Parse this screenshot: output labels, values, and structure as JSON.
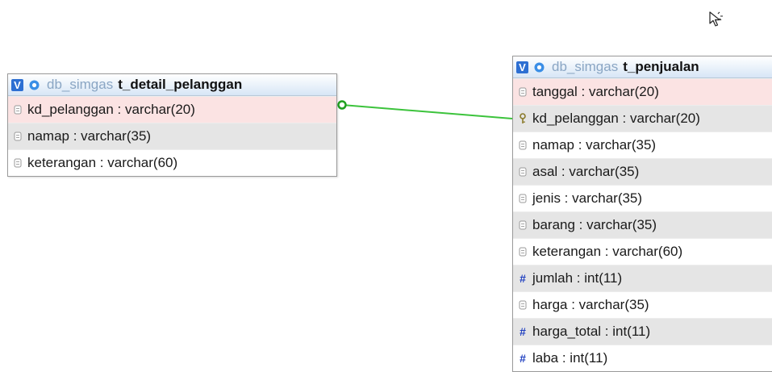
{
  "tables": {
    "detail": {
      "toggle": "V",
      "db": "db_simgas",
      "name": "t_detail_pelanggan",
      "columns": [
        {
          "text": "kd_pelanggan : varchar(20)",
          "type": "text",
          "bg": "pink"
        },
        {
          "text": "namap : varchar(35)",
          "type": "text",
          "bg": "gray"
        },
        {
          "text": "keterangan : varchar(60)",
          "type": "text",
          "bg": "white"
        }
      ]
    },
    "penjualan": {
      "toggle": "V",
      "db": "db_simgas",
      "name": "t_penjualan",
      "columns": [
        {
          "text": "tanggal : varchar(20)",
          "type": "text",
          "bg": "pink"
        },
        {
          "text": "kd_pelanggan : varchar(20)",
          "type": "key",
          "bg": "gray"
        },
        {
          "text": "namap : varchar(35)",
          "type": "text",
          "bg": "white"
        },
        {
          "text": "asal : varchar(35)",
          "type": "text",
          "bg": "gray"
        },
        {
          "text": "jenis : varchar(35)",
          "type": "text",
          "bg": "white"
        },
        {
          "text": "barang : varchar(35)",
          "type": "text",
          "bg": "gray"
        },
        {
          "text": "keterangan : varchar(60)",
          "type": "text",
          "bg": "white"
        },
        {
          "text": "jumlah : int(11)",
          "type": "number",
          "bg": "gray"
        },
        {
          "text": "harga : varchar(35)",
          "type": "text",
          "bg": "white"
        },
        {
          "text": "harga_total : int(11)",
          "type": "number",
          "bg": "gray"
        },
        {
          "text": "laba : int(11)",
          "type": "number",
          "bg": "white"
        }
      ]
    }
  },
  "colors": {
    "relation_line": "#3cc33c",
    "toggle_bg": "#2d6fd2",
    "db_name": "#8aa6c4",
    "number_icon": "#2040c0"
  }
}
